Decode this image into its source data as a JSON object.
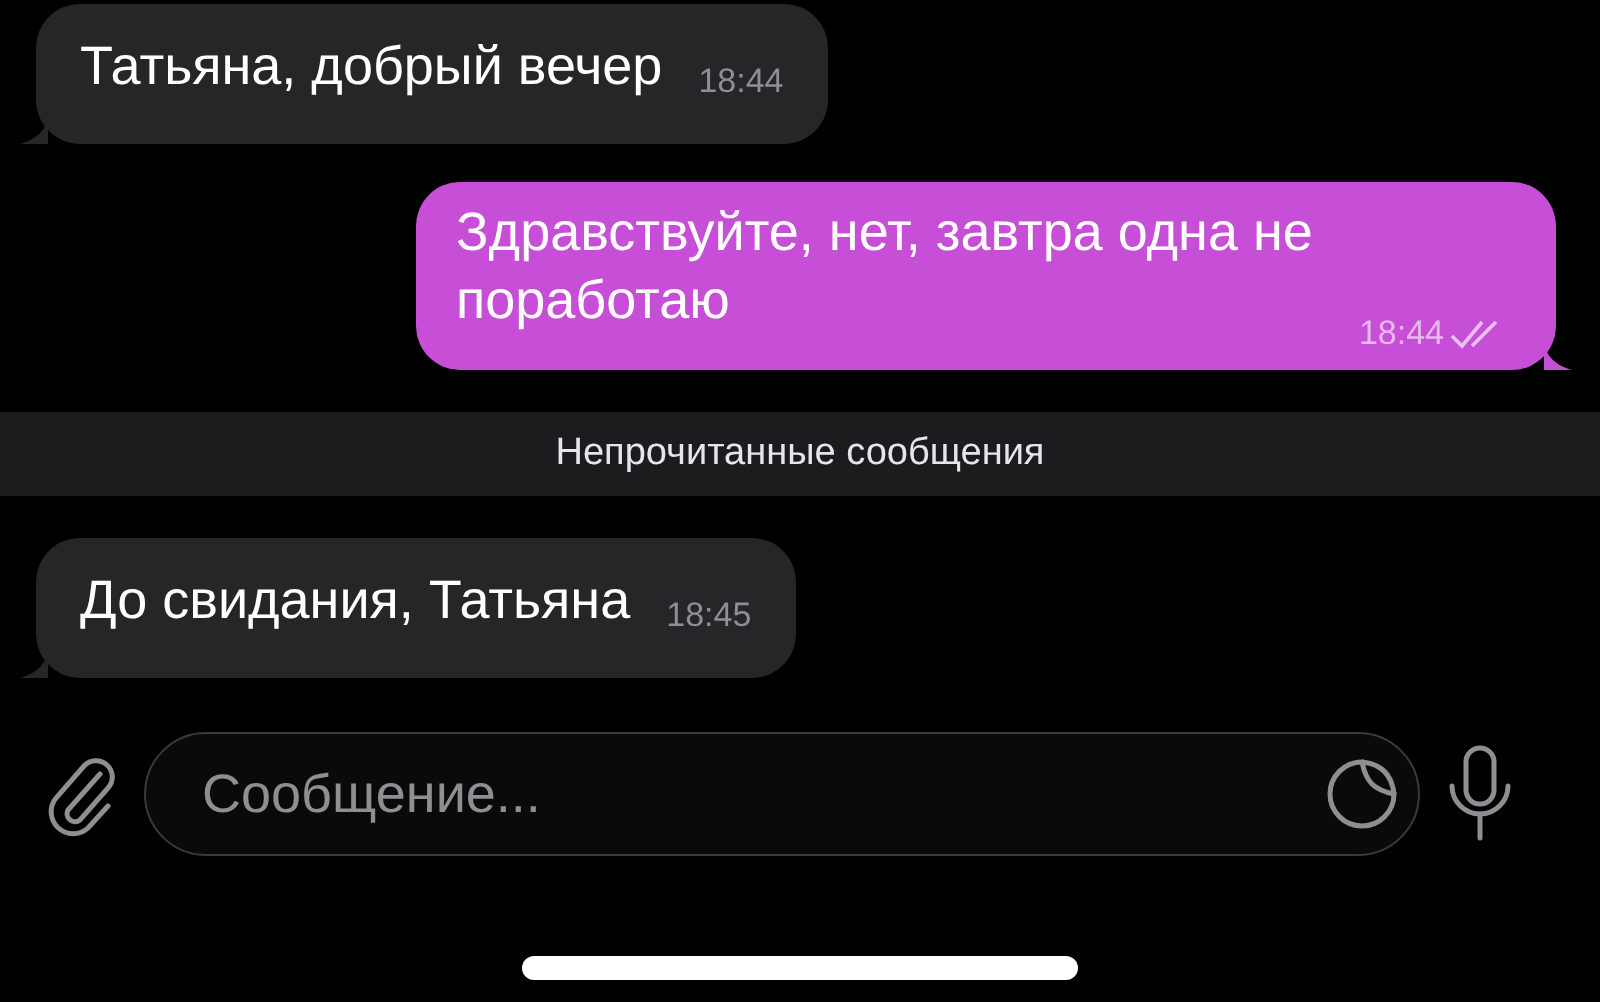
{
  "items": [
    {
      "kind": "incoming",
      "text": "Татьяна, добрый вечер",
      "time": "18:44"
    },
    {
      "kind": "outgoing",
      "text": "Здравствуйте, нет, завтра одна не поработаю",
      "time": "18:44",
      "read": true
    },
    {
      "kind": "divider",
      "text": "Непрочитанные сообщения"
    },
    {
      "kind": "incoming",
      "text": "До свидания, Татьяна",
      "time": "18:45"
    }
  ],
  "composer": {
    "placeholder": "Сообщение..."
  }
}
